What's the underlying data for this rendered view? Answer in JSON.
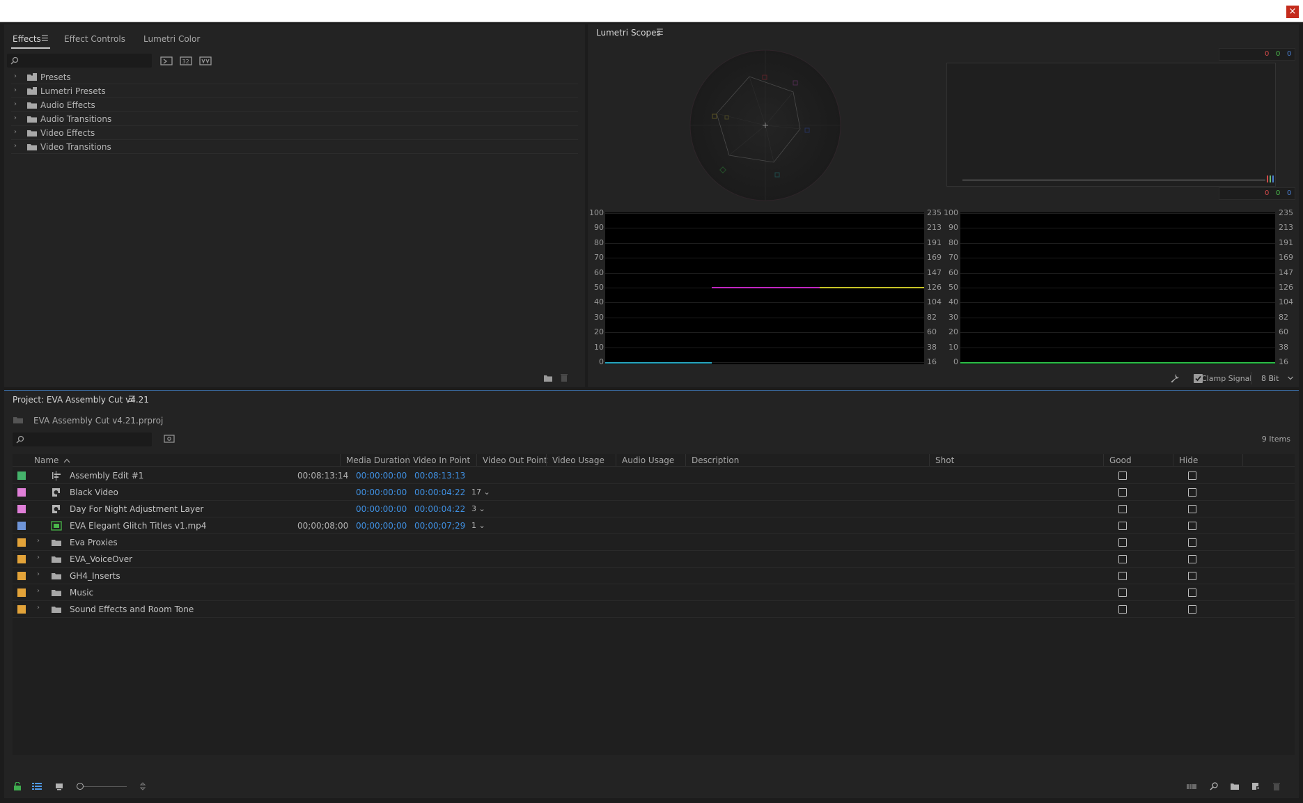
{
  "window": {
    "close_glyph": "×"
  },
  "effects_panel": {
    "tabs": [
      "Effects",
      "Effect Controls",
      "Lumetri Color"
    ],
    "menu_glyph": "☰",
    "search_placeholder": "",
    "tree": [
      "Presets",
      "Lumetri Presets",
      "Audio Effects",
      "Audio Transitions",
      "Video Effects",
      "Video Transitions"
    ],
    "chevron": "›"
  },
  "scopes_panel": {
    "title": "Lumetri Scopes",
    "menu_glyph": "☰",
    "rgb_top": [
      "0",
      "0",
      "0"
    ],
    "rgb_bottom": [
      "0",
      "0",
      "0"
    ],
    "ire_scale": [
      "100",
      "90",
      "80",
      "70",
      "60",
      "50",
      "40",
      "30",
      "20",
      "10",
      "0"
    ],
    "code_scale": [
      "235",
      "213",
      "191",
      "169",
      "147",
      "126",
      "104",
      "82",
      "60",
      "38",
      "16"
    ],
    "clamp_signal_label": "Clamp Signal",
    "clamp_signal_checked": true,
    "bit_depth": "8 Bit",
    "waveform_trace_level": 50,
    "vectorscope_targets": [
      "R",
      "Mg",
      "B",
      "Cy",
      "G",
      "Yl"
    ]
  },
  "project_panel": {
    "title": "Project: EVA Assembly Cut v4.21",
    "menu_glyph": "☰",
    "project_file": "EVA Assembly Cut v4.21.prproj",
    "item_count": "9 Items",
    "columns": [
      "Name",
      "Media Duration",
      "Video In Point",
      "Video Out Point",
      "Video Usage",
      "Audio Usage",
      "Description",
      "Shot",
      "Good",
      "Hide"
    ],
    "sort_glyph": "^",
    "rows": [
      {
        "name": "Assembly Edit #1",
        "color": "#45b36b",
        "type": "sequence",
        "duration": "00:08:13:14",
        "in": "00:00:00:00",
        "out": "00:08:13:13",
        "usage": ""
      },
      {
        "name": "Black Video",
        "color": "#e07fd8",
        "type": "synthetic",
        "duration": "",
        "in": "00:00:00:00",
        "out": "00:00:04:22",
        "usage": "17 ⌄"
      },
      {
        "name": "Day For Night Adjustment Layer",
        "color": "#e07fd8",
        "type": "synthetic",
        "duration": "",
        "in": "00:00:00:00",
        "out": "00:00:04:22",
        "usage": "3 ⌄"
      },
      {
        "name": "EVA Elegant Glitch Titles v1.mp4",
        "color": "#6f95d8",
        "type": "clip",
        "duration": "00;00;08;00",
        "in": "00;00;00;00",
        "out": "00;00;07;29",
        "usage": "1 ⌄"
      },
      {
        "name": "Eva Proxies",
        "color": "#e3a339",
        "type": "bin",
        "duration": "",
        "in": "",
        "out": "",
        "usage": ""
      },
      {
        "name": "EVA_VoiceOver",
        "color": "#e3a339",
        "type": "bin",
        "duration": "",
        "in": "",
        "out": "",
        "usage": ""
      },
      {
        "name": "GH4_Inserts",
        "color": "#e3a339",
        "type": "bin",
        "duration": "",
        "in": "",
        "out": "",
        "usage": ""
      },
      {
        "name": "Music",
        "color": "#e3a339",
        "type": "bin",
        "duration": "",
        "in": "",
        "out": "",
        "usage": ""
      },
      {
        "name": "Sound Effects and Room Tone",
        "color": "#e3a339",
        "type": "bin",
        "duration": "",
        "in": "",
        "out": "",
        "usage": ""
      }
    ]
  }
}
